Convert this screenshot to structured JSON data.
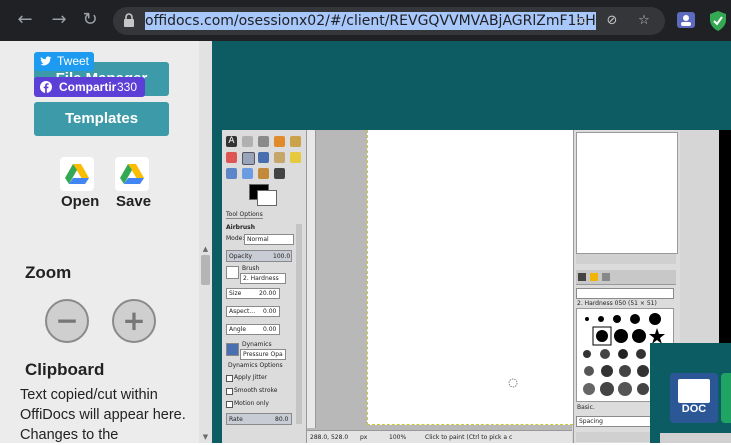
{
  "browser": {
    "url": "offidocs.com/osessionx02/#/client/REVGQVVMVABjAGRlZmF1bH",
    "back_icon": "arrow-left-icon",
    "forward_icon": "arrow-right-icon",
    "reload_icon": "reload-icon"
  },
  "social": {
    "tweet_label": "Tweet",
    "share_label": "Compartir",
    "share_count": "330"
  },
  "sidebar": {
    "file_manager_label": "File Manager",
    "templates_label": "Templates",
    "open_label": "Open",
    "save_label": "Save",
    "zoom_title": "Zoom",
    "zoom_out_glyph": "−",
    "zoom_in_glyph": "+",
    "clipboard_title": "Clipboard",
    "clipboard_text": "Text copied/cut within OffiDocs will appear here. Changes to the"
  },
  "gimp": {
    "tool_options_tab": "Tool Options",
    "tool_name": "Airbrush",
    "mode_label": "Mode:",
    "mode_value": "Normal",
    "opacity_label": "Opacity",
    "opacity_value": "100.0",
    "brush_label": "Brush",
    "brush_value": "2. Hardness",
    "size_label": "Size",
    "size_value": "20.00",
    "aspect_label": "Aspect...",
    "aspect_value": "0.00",
    "angle_label": "Angle",
    "angle_value": "0.00",
    "dynamics_label": "Dynamics",
    "dynamics_value": "Pressure Opa",
    "dynamics_options": "Dynamics Options",
    "apply_jitter": "Apply Jitter",
    "smooth_stroke": "Smooth stroke",
    "motion_only": "Motion only",
    "rate_label": "Rate",
    "rate_value": "80.0",
    "coords": "288.0, 528.0",
    "unit": "px",
    "zoom": "100%",
    "status": "Click to paint (Ctrl to pick a c",
    "brush_panel_title": "2. Hardness 050 (51 × 51)",
    "basic_label": "Basic.",
    "spacing_label": "Spacing"
  },
  "popup": {
    "doc_label": "DOC"
  },
  "colors": {
    "teal_header": "#0d5c63",
    "teal_button": "#3d9aa8",
    "tweet_blue": "#1d9bf0",
    "share_purple": "#5b3fd6",
    "doc_blue": "#2b5797"
  }
}
